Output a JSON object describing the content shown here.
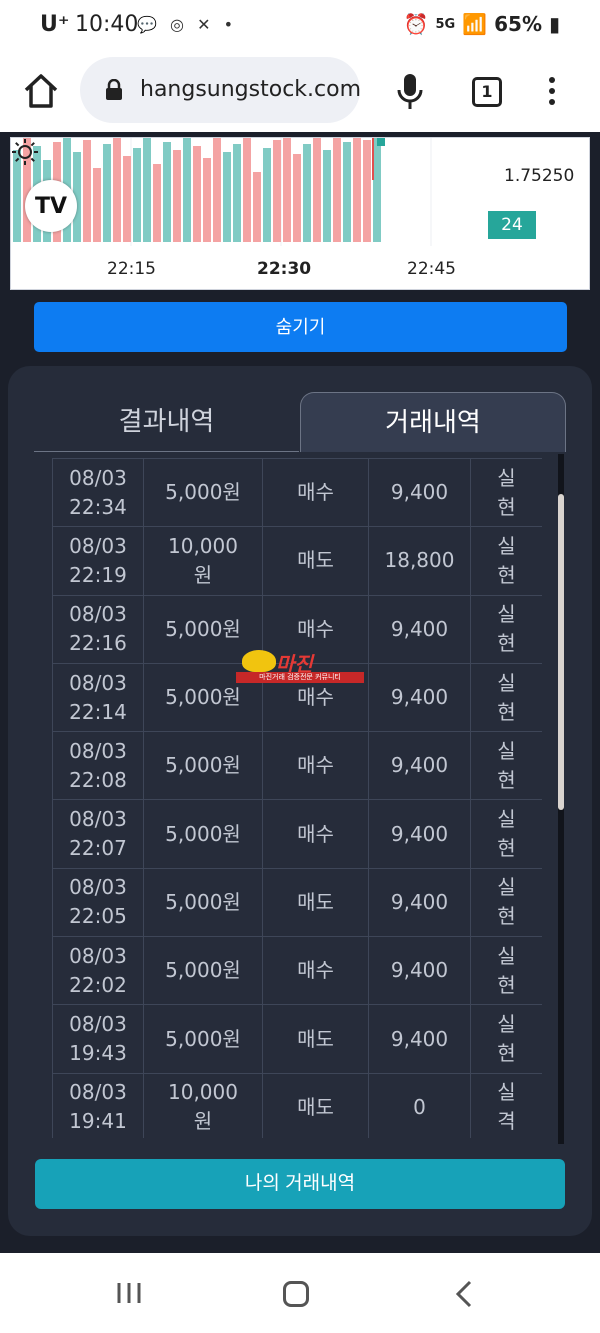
{
  "status_bar": {
    "carrier": "U⁺",
    "time": "10:40",
    "left_icons": [
      "talk-icon",
      "dot-icon"
    ],
    "network": "5G",
    "battery": "65%"
  },
  "browser": {
    "url": "hangsungstock.com",
    "tab_count": "1"
  },
  "chart_data": {
    "type": "bar",
    "price_label": "1.75250",
    "count_badge": "24",
    "x_ticks": [
      "22:15",
      "22:30",
      "22:45"
    ],
    "colors": {
      "up": "#80cbc4",
      "down": "#f4a3a3"
    }
  },
  "hide_button": "숨기기",
  "tabs": [
    {
      "label": "결과내역",
      "active": false
    },
    {
      "label": "거래내역",
      "active": true
    }
  ],
  "trades": [
    {
      "date": "08/03",
      "time": "22:34",
      "amount": "5,000원",
      "side": "매수",
      "price": "9,400",
      "status": "실현",
      "status_type": "win"
    },
    {
      "date": "08/03",
      "time": "22:19",
      "amount": "10,000원",
      "side": "매도",
      "price": "18,800",
      "status": "실현",
      "status_type": "win"
    },
    {
      "date": "08/03",
      "time": "22:16",
      "amount": "5,000원",
      "side": "매수",
      "price": "9,400",
      "status": "실현",
      "status_type": "win"
    },
    {
      "date": "08/03",
      "time": "22:14",
      "amount": "5,000원",
      "side": "매수",
      "price": "9,400",
      "status": "실현",
      "status_type": "win"
    },
    {
      "date": "08/03",
      "time": "22:08",
      "amount": "5,000원",
      "side": "매수",
      "price": "9,400",
      "status": "실현",
      "status_type": "win"
    },
    {
      "date": "08/03",
      "time": "22:07",
      "amount": "5,000원",
      "side": "매수",
      "price": "9,400",
      "status": "실현",
      "status_type": "win"
    },
    {
      "date": "08/03",
      "time": "22:05",
      "amount": "5,000원",
      "side": "매도",
      "price": "9,400",
      "status": "실현",
      "status_type": "win"
    },
    {
      "date": "08/03",
      "time": "22:02",
      "amount": "5,000원",
      "side": "매수",
      "price": "9,400",
      "status": "실현",
      "status_type": "win"
    },
    {
      "date": "08/03",
      "time": "19:43",
      "amount": "5,000원",
      "side": "매도",
      "price": "9,400",
      "status": "실현",
      "status_type": "win"
    },
    {
      "date": "08/03",
      "time": "19:41",
      "amount": "10,000원",
      "side": "매도",
      "price": "0",
      "status": "실격",
      "status_type": "loss"
    }
  ],
  "watermark": {
    "main": "마진",
    "sub": "마진거래 검증전문 커뮤니티"
  },
  "my_trades_button": "나의 거래내역",
  "colors": {
    "accent_blue": "#0d7cf2",
    "accent_teal": "#17a2b8",
    "win": "#4caf50",
    "loss": "#e05050"
  }
}
